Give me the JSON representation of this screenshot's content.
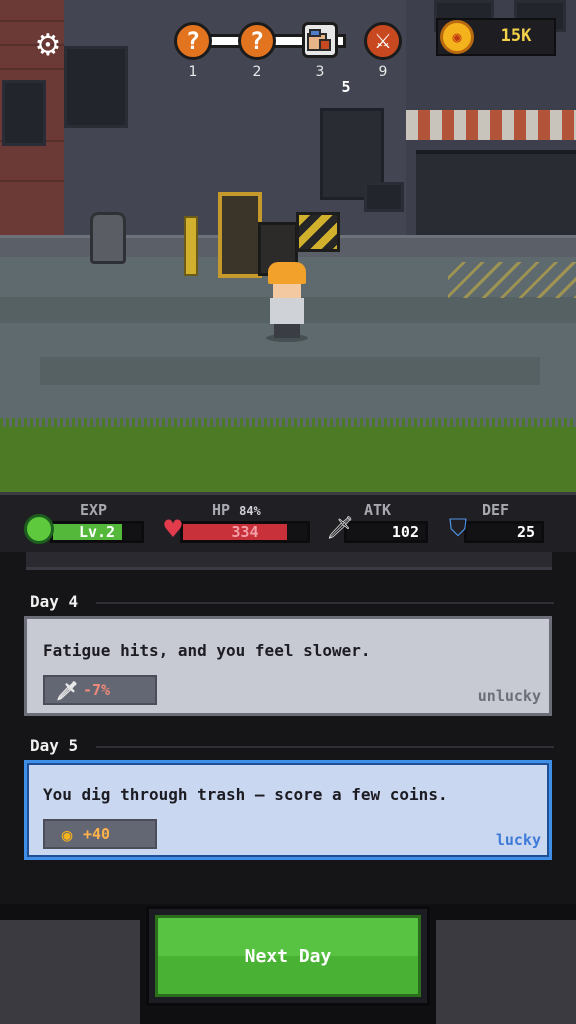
{
  "hud": {
    "settings_icon": "gear-icon",
    "stages": [
      {
        "icon": "question-icon",
        "glyph": "?",
        "number": "1"
      },
      {
        "icon": "question-icon",
        "glyph": "?",
        "number": "2"
      },
      {
        "icon": "current-location-icon",
        "glyph": "",
        "number": "3"
      },
      {
        "icon": "sword-boss-icon",
        "glyph": "⚔",
        "number": "9"
      }
    ],
    "current_day": "5",
    "coins": "15K",
    "coin_icon": "coin-icon"
  },
  "stats": {
    "exp_label": "EXP",
    "level": "Lv.2",
    "exp_fraction": 0.78,
    "hp_label": "HP",
    "hp_percent": "84%",
    "hp_fraction": 0.84,
    "hp_value": "334",
    "atk_label": "ATK",
    "atk_value": "102",
    "def_label": "DEF",
    "def_value": "25",
    "colors": {
      "exp": "#54b83a",
      "hp": "#c8303a",
      "def": "#4f8fe0"
    }
  },
  "log": {
    "entries": [
      {
        "day": "Day 4",
        "text": "Fatigue hits, and you feel slower.",
        "effect_icon": "sword-icon",
        "effect": "-7%",
        "tag": "unlucky"
      },
      {
        "day": "Day 5",
        "text": "You dig through trash — score a few coins.",
        "effect_icon": "coin-icon",
        "effect": "+40",
        "tag": "lucky"
      }
    ]
  },
  "actions": {
    "next_day_label": "Next Day"
  }
}
